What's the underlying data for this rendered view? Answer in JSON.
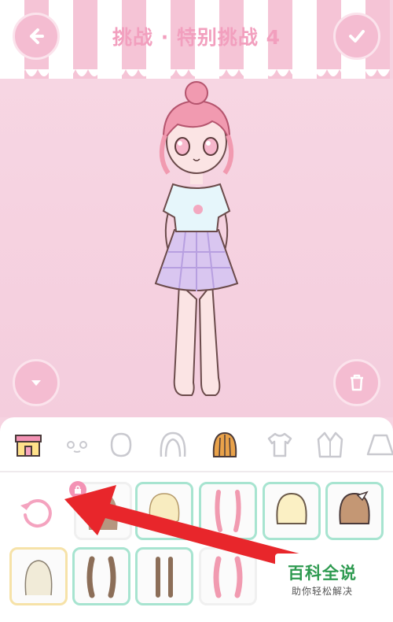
{
  "header": {
    "title": "挑战 · 特别挑战 4",
    "back_icon": "arrow-left-icon",
    "confirm_icon": "checkmark-icon"
  },
  "stage": {
    "collapse_icon": "triangle-down-icon",
    "delete_icon": "trash-icon"
  },
  "categories": [
    {
      "name": "shop",
      "icon": "shop-icon"
    },
    {
      "name": "face",
      "icon": "face-icon"
    },
    {
      "name": "head",
      "icon": "head-shape-icon"
    },
    {
      "name": "front-hair",
      "icon": "hair-front-icon"
    },
    {
      "name": "back-hair",
      "icon": "hair-back-icon",
      "selected": true
    },
    {
      "name": "top",
      "icon": "tshirt-icon"
    },
    {
      "name": "jacket",
      "icon": "jacket-icon"
    },
    {
      "name": "skirt",
      "icon": "skirt-icon"
    }
  ],
  "items": {
    "reset_icon": "reset-icon",
    "locked_icon": "lock-icon"
  },
  "watermark": {
    "title": "百科全说",
    "subtitle": "助你轻松解决"
  },
  "colors": {
    "pink": "#f4bcd1",
    "title_pink": "#f29fbe",
    "mint_border": "#a7e4d0",
    "arrow_red": "#e8262b",
    "watermark_green": "#2e9a50"
  }
}
